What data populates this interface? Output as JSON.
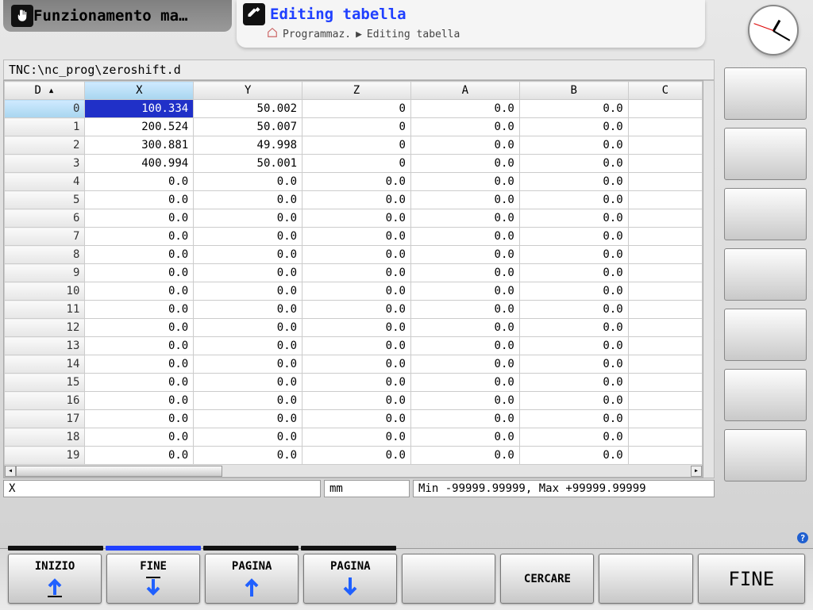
{
  "header": {
    "tab_inactive": "Funzionamento ma…",
    "tab_active_title": "Editing tabella",
    "breadcrumb_root": "Programmaz.",
    "breadcrumb_leaf": "Editing tabella"
  },
  "path": "TNC:\\nc_prog\\zeroshift.d",
  "table": {
    "columns": [
      "D",
      "X",
      "Y",
      "Z",
      "A",
      "B",
      "C"
    ],
    "sorted_col": "D",
    "selected_row": 0,
    "selected_col": "X",
    "rows": [
      {
        "D": 0,
        "X": "100.334",
        "Y": "50.002",
        "Z": "0",
        "A": "0.0",
        "B": "0.0",
        "C": ""
      },
      {
        "D": 1,
        "X": "200.524",
        "Y": "50.007",
        "Z": "0",
        "A": "0.0",
        "B": "0.0",
        "C": ""
      },
      {
        "D": 2,
        "X": "300.881",
        "Y": "49.998",
        "Z": "0",
        "A": "0.0",
        "B": "0.0",
        "C": ""
      },
      {
        "D": 3,
        "X": "400.994",
        "Y": "50.001",
        "Z": "0",
        "A": "0.0",
        "B": "0.0",
        "C": ""
      },
      {
        "D": 4,
        "X": "0.0",
        "Y": "0.0",
        "Z": "0.0",
        "A": "0.0",
        "B": "0.0",
        "C": ""
      },
      {
        "D": 5,
        "X": "0.0",
        "Y": "0.0",
        "Z": "0.0",
        "A": "0.0",
        "B": "0.0",
        "C": ""
      },
      {
        "D": 6,
        "X": "0.0",
        "Y": "0.0",
        "Z": "0.0",
        "A": "0.0",
        "B": "0.0",
        "C": ""
      },
      {
        "D": 7,
        "X": "0.0",
        "Y": "0.0",
        "Z": "0.0",
        "A": "0.0",
        "B": "0.0",
        "C": ""
      },
      {
        "D": 8,
        "X": "0.0",
        "Y": "0.0",
        "Z": "0.0",
        "A": "0.0",
        "B": "0.0",
        "C": ""
      },
      {
        "D": 9,
        "X": "0.0",
        "Y": "0.0",
        "Z": "0.0",
        "A": "0.0",
        "B": "0.0",
        "C": ""
      },
      {
        "D": 10,
        "X": "0.0",
        "Y": "0.0",
        "Z": "0.0",
        "A": "0.0",
        "B": "0.0",
        "C": ""
      },
      {
        "D": 11,
        "X": "0.0",
        "Y": "0.0",
        "Z": "0.0",
        "A": "0.0",
        "B": "0.0",
        "C": ""
      },
      {
        "D": 12,
        "X": "0.0",
        "Y": "0.0",
        "Z": "0.0",
        "A": "0.0",
        "B": "0.0",
        "C": ""
      },
      {
        "D": 13,
        "X": "0.0",
        "Y": "0.0",
        "Z": "0.0",
        "A": "0.0",
        "B": "0.0",
        "C": ""
      },
      {
        "D": 14,
        "X": "0.0",
        "Y": "0.0",
        "Z": "0.0",
        "A": "0.0",
        "B": "0.0",
        "C": ""
      },
      {
        "D": 15,
        "X": "0.0",
        "Y": "0.0",
        "Z": "0.0",
        "A": "0.0",
        "B": "0.0",
        "C": ""
      },
      {
        "D": 16,
        "X": "0.0",
        "Y": "0.0",
        "Z": "0.0",
        "A": "0.0",
        "B": "0.0",
        "C": ""
      },
      {
        "D": 17,
        "X": "0.0",
        "Y": "0.0",
        "Z": "0.0",
        "A": "0.0",
        "B": "0.0",
        "C": ""
      },
      {
        "D": 18,
        "X": "0.0",
        "Y": "0.0",
        "Z": "0.0",
        "A": "0.0",
        "B": "0.0",
        "C": ""
      },
      {
        "D": 19,
        "X": "0.0",
        "Y": "0.0",
        "Z": "0.0",
        "A": "0.0",
        "B": "0.0",
        "C": ""
      }
    ]
  },
  "status": {
    "column": "X",
    "unit": "mm",
    "range": "Min -99999.99999, Max +99999.99999"
  },
  "softkeys": {
    "sk1": "INIZIO",
    "sk2": "FINE",
    "sk3": "PAGINA",
    "sk4": "PAGINA",
    "sk5": "",
    "sk6": "CERCARE",
    "sk7": "",
    "sk8": "FINE"
  },
  "icons": {
    "arrow_up": "#2060ff",
    "arrow_down": "#2060ff"
  }
}
